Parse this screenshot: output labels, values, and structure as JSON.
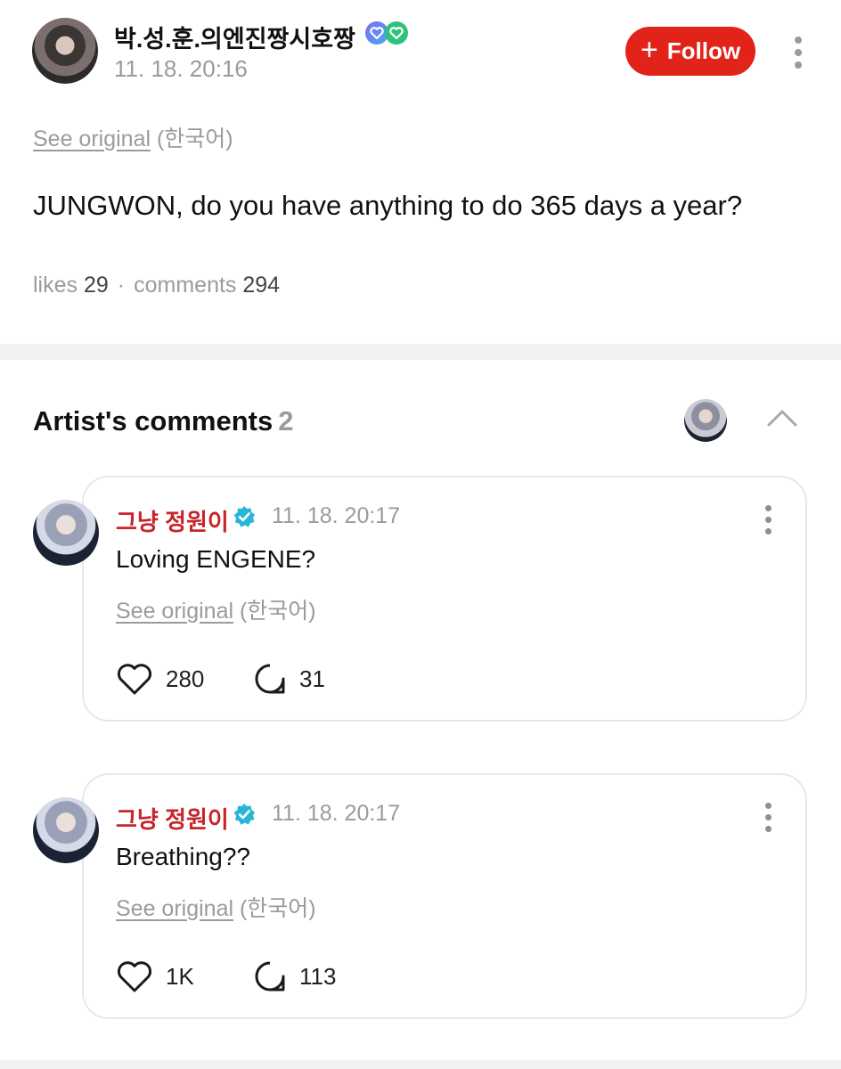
{
  "post": {
    "author": "박.성.훈.의엔진짱시호짱",
    "time": "11. 18. 20:16",
    "follow_label": "Follow",
    "see_original": "See original",
    "language": "(한국어)",
    "text": "JUNGWON, do you have anything to do 365 days a year?",
    "likes_label": "likes",
    "likes": "29",
    "separator": "·",
    "comments_label": "comments",
    "comments": "294"
  },
  "artist_comments": {
    "title": "Artist's comments",
    "count": "2",
    "items": [
      {
        "name": "그냥 정원이",
        "time": "11. 18. 20:17",
        "text": "Loving ENGENE?",
        "see_original": "See original",
        "language": "(한국어)",
        "likes": "280",
        "replies": "31"
      },
      {
        "name": "그냥 정원이",
        "time": "11. 18. 20:17",
        "text": "Breathing??",
        "see_original": "See original",
        "language": "(한국어)",
        "likes": "1K",
        "replies": "113"
      }
    ]
  },
  "colors": {
    "follow_bg": "#e2231a",
    "artist_name": "#c8242a",
    "verified": "#27b7d6",
    "muted": "#9b9b9b"
  },
  "icons": [
    "plus-icon",
    "more-vertical-icon",
    "chevron-up-icon",
    "verified-icon",
    "heart-icon",
    "comment-bubble-icon"
  ]
}
